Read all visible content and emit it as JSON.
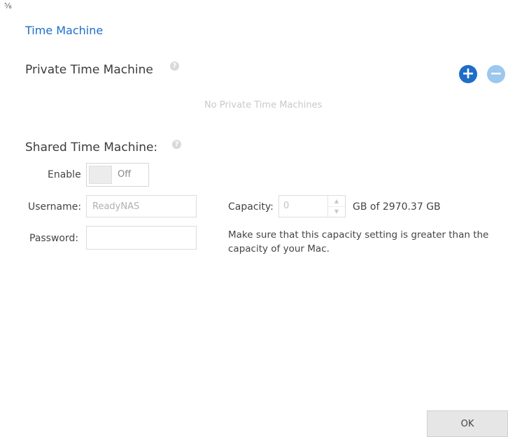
{
  "window": {
    "corner_glyph": "⅝",
    "title": "Time Machine"
  },
  "private": {
    "title": "Private Time Machine",
    "help_glyph": "?",
    "add_glyph": "+",
    "remove_glyph": "−",
    "empty_text": "No Private Time Machines"
  },
  "shared": {
    "title": "Shared Time Machine:",
    "help_glyph": "?",
    "enable_label": "Enable",
    "toggle_state": "Off",
    "username_label": "Username:",
    "username_value": "ReadyNAS",
    "password_label": "Password:",
    "password_value": "",
    "capacity_label": "Capacity:",
    "capacity_value": "0",
    "capacity_suffix": "GB of 2970.37 GB",
    "note": "Make sure that this capacity setting is greater than the capacity of your Mac."
  },
  "footer": {
    "ok_label": "OK"
  },
  "colors": {
    "accent": "#1e6ec8",
    "accent_light": "#9cc7ee"
  },
  "icons": {
    "add": "plus-circle-icon",
    "remove": "minus-circle-icon",
    "help": "question-circle-icon"
  }
}
